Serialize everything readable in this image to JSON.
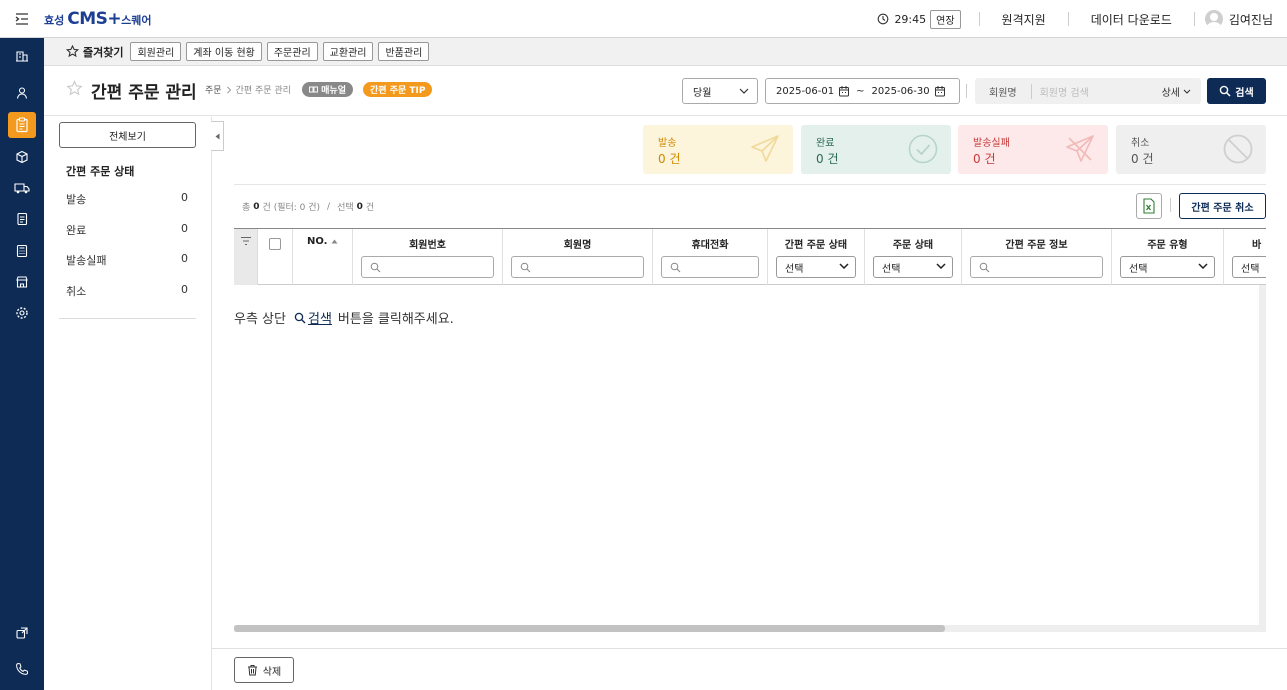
{
  "topbar": {
    "logo_prefix": "효성",
    "logo_main": "CMS+",
    "logo_suffix": "스퀘어",
    "timer": "29:45",
    "extend_label": "연장",
    "remote_support": "원격지원",
    "data_download": "데이터 다운로드",
    "user_name": "김여진님"
  },
  "nav": {
    "icons": [
      "building-icon",
      "person-icon",
      "clipboard-icon",
      "box-icon",
      "truck-icon",
      "document-icon",
      "calculator-icon",
      "store-icon",
      "settings-icon",
      "external-icon",
      "phone-icon"
    ],
    "active": "clipboard-icon",
    "active_color": "#f39a1e",
    "bg_color": "#0d2b55"
  },
  "favorites": {
    "title": "즐겨찾기",
    "items": [
      "회원관리",
      "계좌 이동 현황",
      "주문관리",
      "교환관리",
      "반품관리"
    ]
  },
  "header": {
    "title": "간편 주문 관리",
    "breadcrumb_root": "주문",
    "breadcrumb_current": "간편 주문 관리",
    "manual_badge": "매뉴얼",
    "tip_badge": "간편 주문 TIP",
    "period_select": "당월",
    "date_from": "2025-06-01",
    "date_sep": "~",
    "date_to": "2025-06-30",
    "search_field": "회원명",
    "search_placeholder": "회원명 검색",
    "detail_label": "상세",
    "search_button": "검색"
  },
  "side": {
    "view_all": "전체보기",
    "heading": "간편 주문 상태",
    "rows": [
      {
        "label": "발송",
        "count": "0"
      },
      {
        "label": "완료",
        "count": "0"
      },
      {
        "label": "발송실패",
        "count": "0"
      },
      {
        "label": "취소",
        "count": "0"
      }
    ]
  },
  "stats": {
    "send": {
      "label": "발송",
      "count": "0 건"
    },
    "done": {
      "label": "완료",
      "count": "0 건"
    },
    "fail": {
      "label": "발송실패",
      "count": "0 건"
    },
    "cancel": {
      "label": "취소",
      "count": "0 건"
    }
  },
  "summary": {
    "total_prefix": "총",
    "total": "0",
    "total_suffix": "건 (필터: 0 건)",
    "divider": "/",
    "selected_prefix": "선택",
    "selected": "0",
    "selected_suffix": "건"
  },
  "actions": {
    "cancel_order": "간편 주문 취소",
    "delete": "삭제"
  },
  "table": {
    "columns": {
      "no": "NO.",
      "member_no": "회원번호",
      "member_name": "회원명",
      "phone": "휴대전화",
      "simple_status": "간편 주문 상태",
      "order_status": "주문 상태",
      "simple_info": "간편 주문 정보",
      "order_type": "주문 유형",
      "next": "바"
    },
    "select_placeholder": "선택",
    "empty_prefix": "우측 상단",
    "empty_keyword": "검색",
    "empty_suffix": "버튼을 클릭해주세요."
  }
}
